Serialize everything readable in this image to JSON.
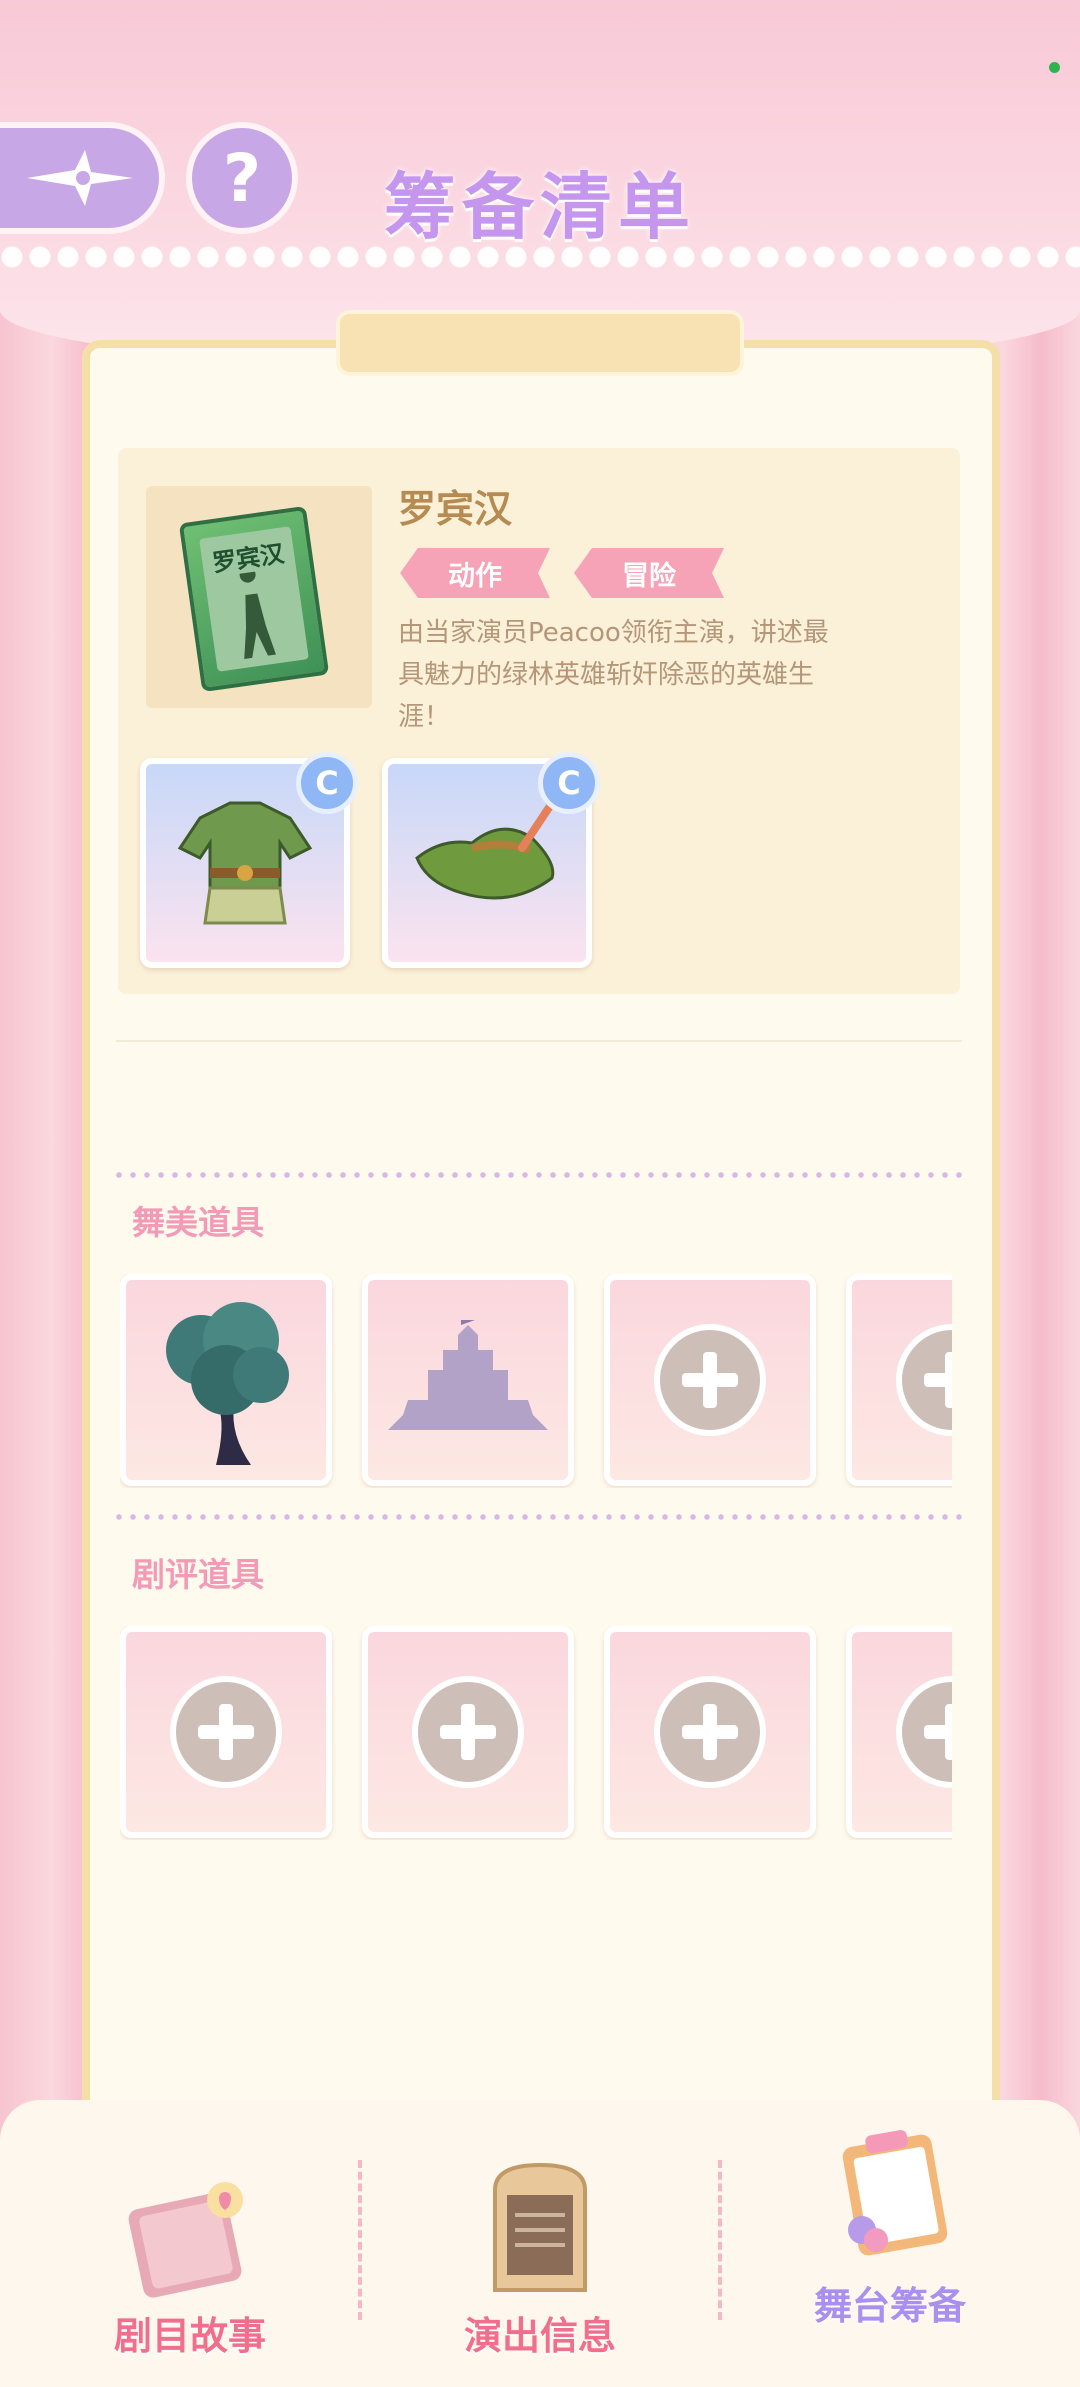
{
  "header": {
    "title": "筹备清单",
    "help_symbol": "?"
  },
  "show": {
    "cover_title": "罗宾汉",
    "name": "罗宾汉",
    "tags": [
      "动作",
      "冒险"
    ],
    "description": "由当家演员Peacoo领衔主演，讲述最具魅力的绿林英雄斩奸除恶的英雄生涯！"
  },
  "costumes": [
    {
      "item": "green-tunic",
      "grade": "C"
    },
    {
      "item": "green-feather-hat",
      "grade": "C"
    }
  ],
  "stage_props": {
    "title": "舞美道具",
    "slots": [
      "tree",
      "castle",
      "empty",
      "empty"
    ]
  },
  "review_props": {
    "title": "剧评道具",
    "slots": [
      "empty",
      "empty",
      "empty",
      "empty"
    ]
  },
  "nav": {
    "items": [
      {
        "label": "剧目故事",
        "icon": "storybook-icon"
      },
      {
        "label": "演出信息",
        "icon": "info-board-icon"
      },
      {
        "label": "舞台筹备",
        "icon": "clipboard-icon",
        "active": true
      }
    ]
  },
  "colors": {
    "accent_purple": "#c596ee",
    "tag_pink": "#f6a3b8",
    "section_pink": "#f39bb6",
    "grade_blue": "#8fb6f5"
  }
}
